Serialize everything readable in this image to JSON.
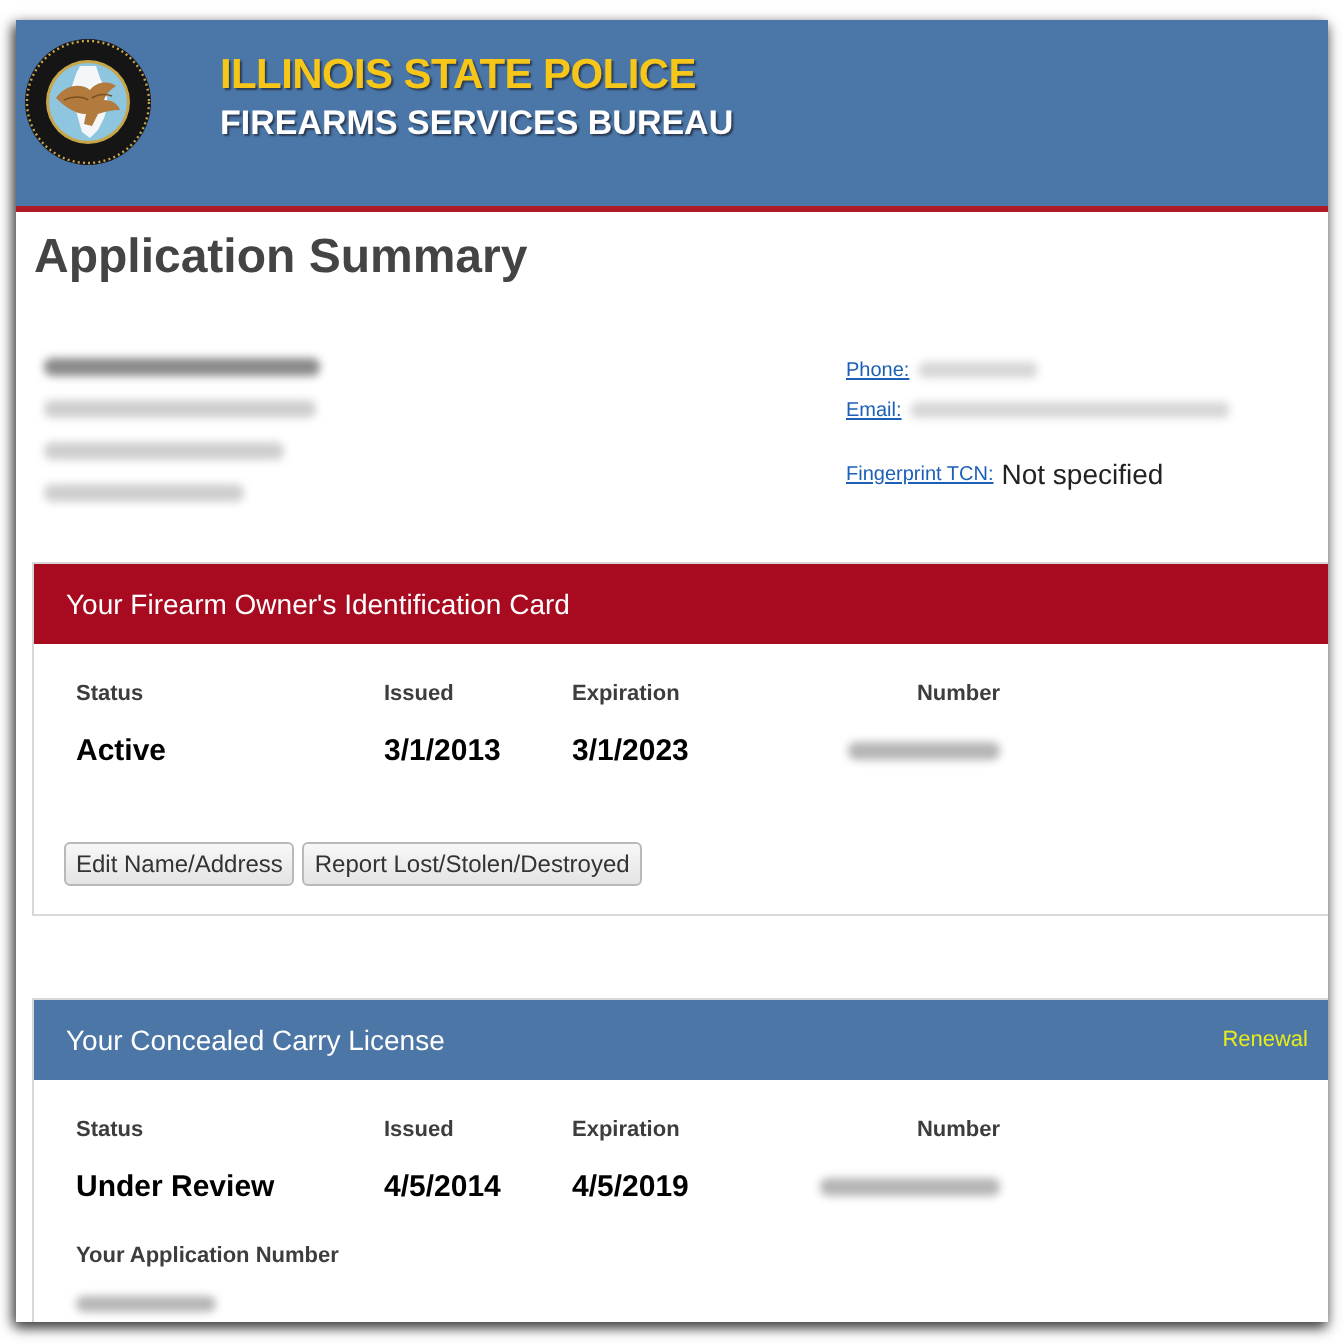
{
  "header": {
    "title": "ILLINOIS STATE POLICE",
    "subtitle": "FIREARMS SERVICES BUREAU"
  },
  "page_title": "Application Summary",
  "applicant": {
    "address_lines": [
      {
        "kind": "name",
        "redacted": true
      },
      {
        "kind": "line",
        "redacted": true
      },
      {
        "kind": "line",
        "redacted": true
      },
      {
        "kind": "line",
        "redacted": true
      }
    ],
    "contacts": [
      {
        "label": "Phone:",
        "redacted": true
      },
      {
        "label": "Email:",
        "redacted": true
      },
      {
        "label": "Fingerprint TCN:",
        "redacted": false,
        "value": "Not specified"
      }
    ]
  },
  "cards": [
    {
      "title": "Your Firearm Owner's Identification Card",
      "color": "#a80a1f",
      "fields": [
        {
          "label": "Status",
          "value": "Active",
          "redacted": false
        },
        {
          "label": "Issued",
          "value": "3/1/2013",
          "redacted": false
        },
        {
          "label": "Expiration",
          "value": "3/1/2023",
          "redacted": false
        },
        {
          "label": "Number",
          "redacted": true
        }
      ],
      "buttons": [
        "Edit Name/Address",
        "Report Lost/Stolen/Destroyed"
      ]
    },
    {
      "title": "Your Concealed Carry License",
      "color": "#4b76a6",
      "link": "Renewal",
      "fields": [
        {
          "label": "Status",
          "value": "Under Review",
          "redacted": false
        },
        {
          "label": "Issued",
          "value": "4/5/2014",
          "redacted": false
        },
        {
          "label": "Expiration",
          "value": "4/5/2019",
          "redacted": false
        },
        {
          "label": "Number",
          "redacted": true
        }
      ],
      "extra_fields": [
        {
          "label": "Your Application Number",
          "redacted": true
        }
      ]
    }
  ]
}
